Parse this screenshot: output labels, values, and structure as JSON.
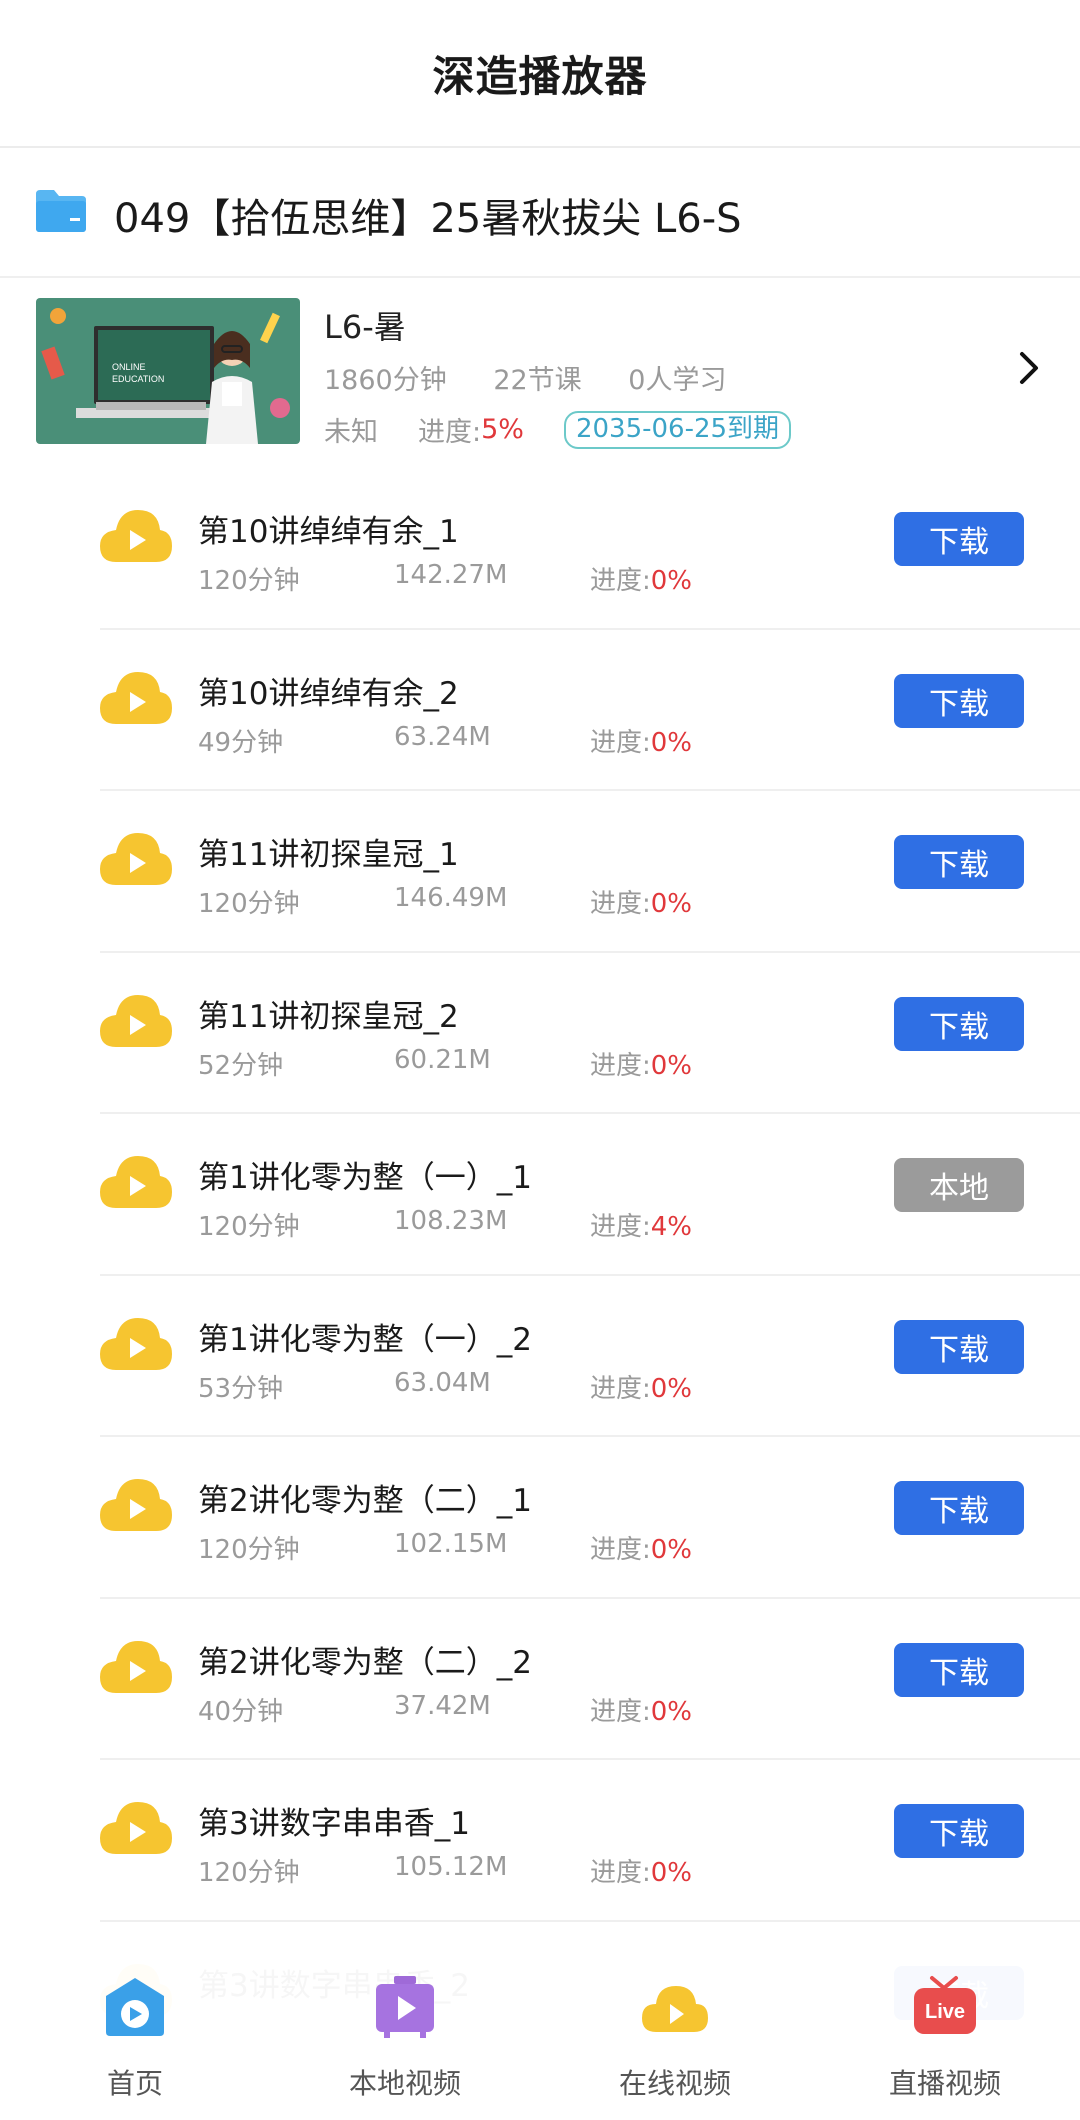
{
  "app": {
    "title": "深造播放器"
  },
  "folder": {
    "title": "049【拾伍思维】25暑秋拔尖 L6-S",
    "icon": "folder-icon"
  },
  "course": {
    "name": "L6-暑",
    "total_minutes": "1860分钟",
    "lesson_count": "22节课",
    "learners": "0人学习",
    "status": "未知",
    "progress_label": "进度:",
    "progress_value": "5%",
    "expiry": "2035-06-25到期",
    "thumbnail_text": "ONLINE EDUCATION"
  },
  "progress_label": "进度:",
  "lessons": [
    {
      "title": "第10讲绰绰有余_1",
      "duration": "120分钟",
      "size": "142.27M",
      "progress": "0%",
      "button": "下载",
      "button_type": "download"
    },
    {
      "title": "第10讲绰绰有余_2",
      "duration": "49分钟",
      "size": "63.24M",
      "progress": "0%",
      "button": "下载",
      "button_type": "download"
    },
    {
      "title": "第11讲初探皇冠_1",
      "duration": "120分钟",
      "size": "146.49M",
      "progress": "0%",
      "button": "下载",
      "button_type": "download"
    },
    {
      "title": "第11讲初探皇冠_2",
      "duration": "52分钟",
      "size": "60.21M",
      "progress": "0%",
      "button": "下载",
      "button_type": "download"
    },
    {
      "title": "第1讲化零为整（一）_1",
      "duration": "120分钟",
      "size": "108.23M",
      "progress": "4%",
      "button": "本地",
      "button_type": "local"
    },
    {
      "title": "第1讲化零为整（一）_2",
      "duration": "53分钟",
      "size": "63.04M",
      "progress": "0%",
      "button": "下载",
      "button_type": "download"
    },
    {
      "title": "第2讲化零为整（二）_1",
      "duration": "120分钟",
      "size": "102.15M",
      "progress": "0%",
      "button": "下载",
      "button_type": "download"
    },
    {
      "title": "第2讲化零为整（二）_2",
      "duration": "40分钟",
      "size": "37.42M",
      "progress": "0%",
      "button": "下载",
      "button_type": "download"
    },
    {
      "title": "第3讲数字串串香_1",
      "duration": "120分钟",
      "size": "105.12M",
      "progress": "0%",
      "button": "下载",
      "button_type": "download"
    },
    {
      "title": "第3讲数字串串香_2",
      "duration": "",
      "size": "",
      "progress": "",
      "button": "下载",
      "button_type": "download"
    }
  ],
  "tabs": [
    {
      "label": "首页",
      "icon": "home-icon"
    },
    {
      "label": "本地视频",
      "icon": "local-video-icon"
    },
    {
      "label": "在线视频",
      "icon": "online-video-icon"
    },
    {
      "label": "直播视频",
      "icon": "live-tv-icon",
      "badge": "Live"
    }
  ],
  "colors": {
    "download_button": "#2f6fe4",
    "local_button": "#9b9b9b",
    "progress_red": "#e0383b",
    "cloud_yellow": "#f6c530",
    "expiry_teal": "#3ba4c7"
  }
}
